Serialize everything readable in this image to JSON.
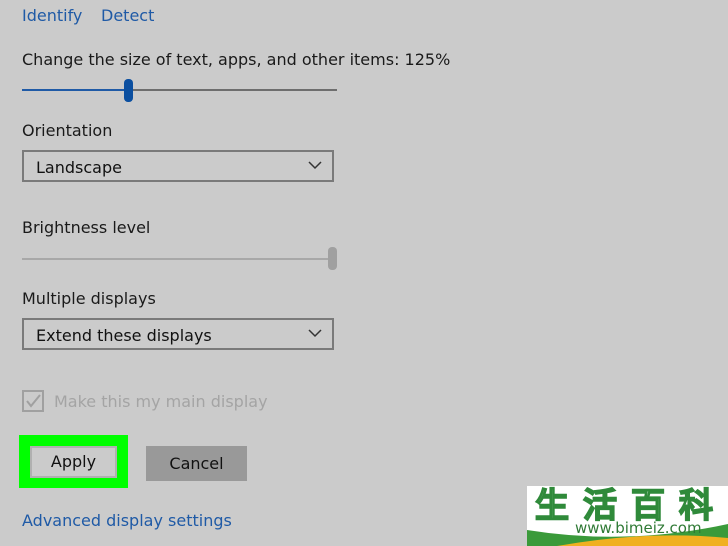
{
  "links": {
    "identify": "Identify",
    "detect": "Detect",
    "advanced": "Advanced display settings"
  },
  "scale": {
    "label": "Change the size of text, apps, and other items: 125%",
    "value_percent": 125,
    "slider_fraction": 0.34
  },
  "orientation": {
    "label": "Orientation",
    "selected": "Landscape"
  },
  "brightness": {
    "label": "Brightness level",
    "slider_fraction": 1.0
  },
  "multiple_displays": {
    "label": "Multiple displays",
    "selected": "Extend these displays"
  },
  "main_display": {
    "label": "Make this my main display",
    "checked": true,
    "disabled": true
  },
  "buttons": {
    "apply": "Apply",
    "cancel": "Cancel"
  },
  "colors": {
    "accent": "#1f5aa6",
    "highlight": "#00ff00",
    "slider_thumb": "#0b4fa0"
  },
  "watermark": {
    "chinese": "生活百科",
    "url": "www.bimeiz.com"
  }
}
